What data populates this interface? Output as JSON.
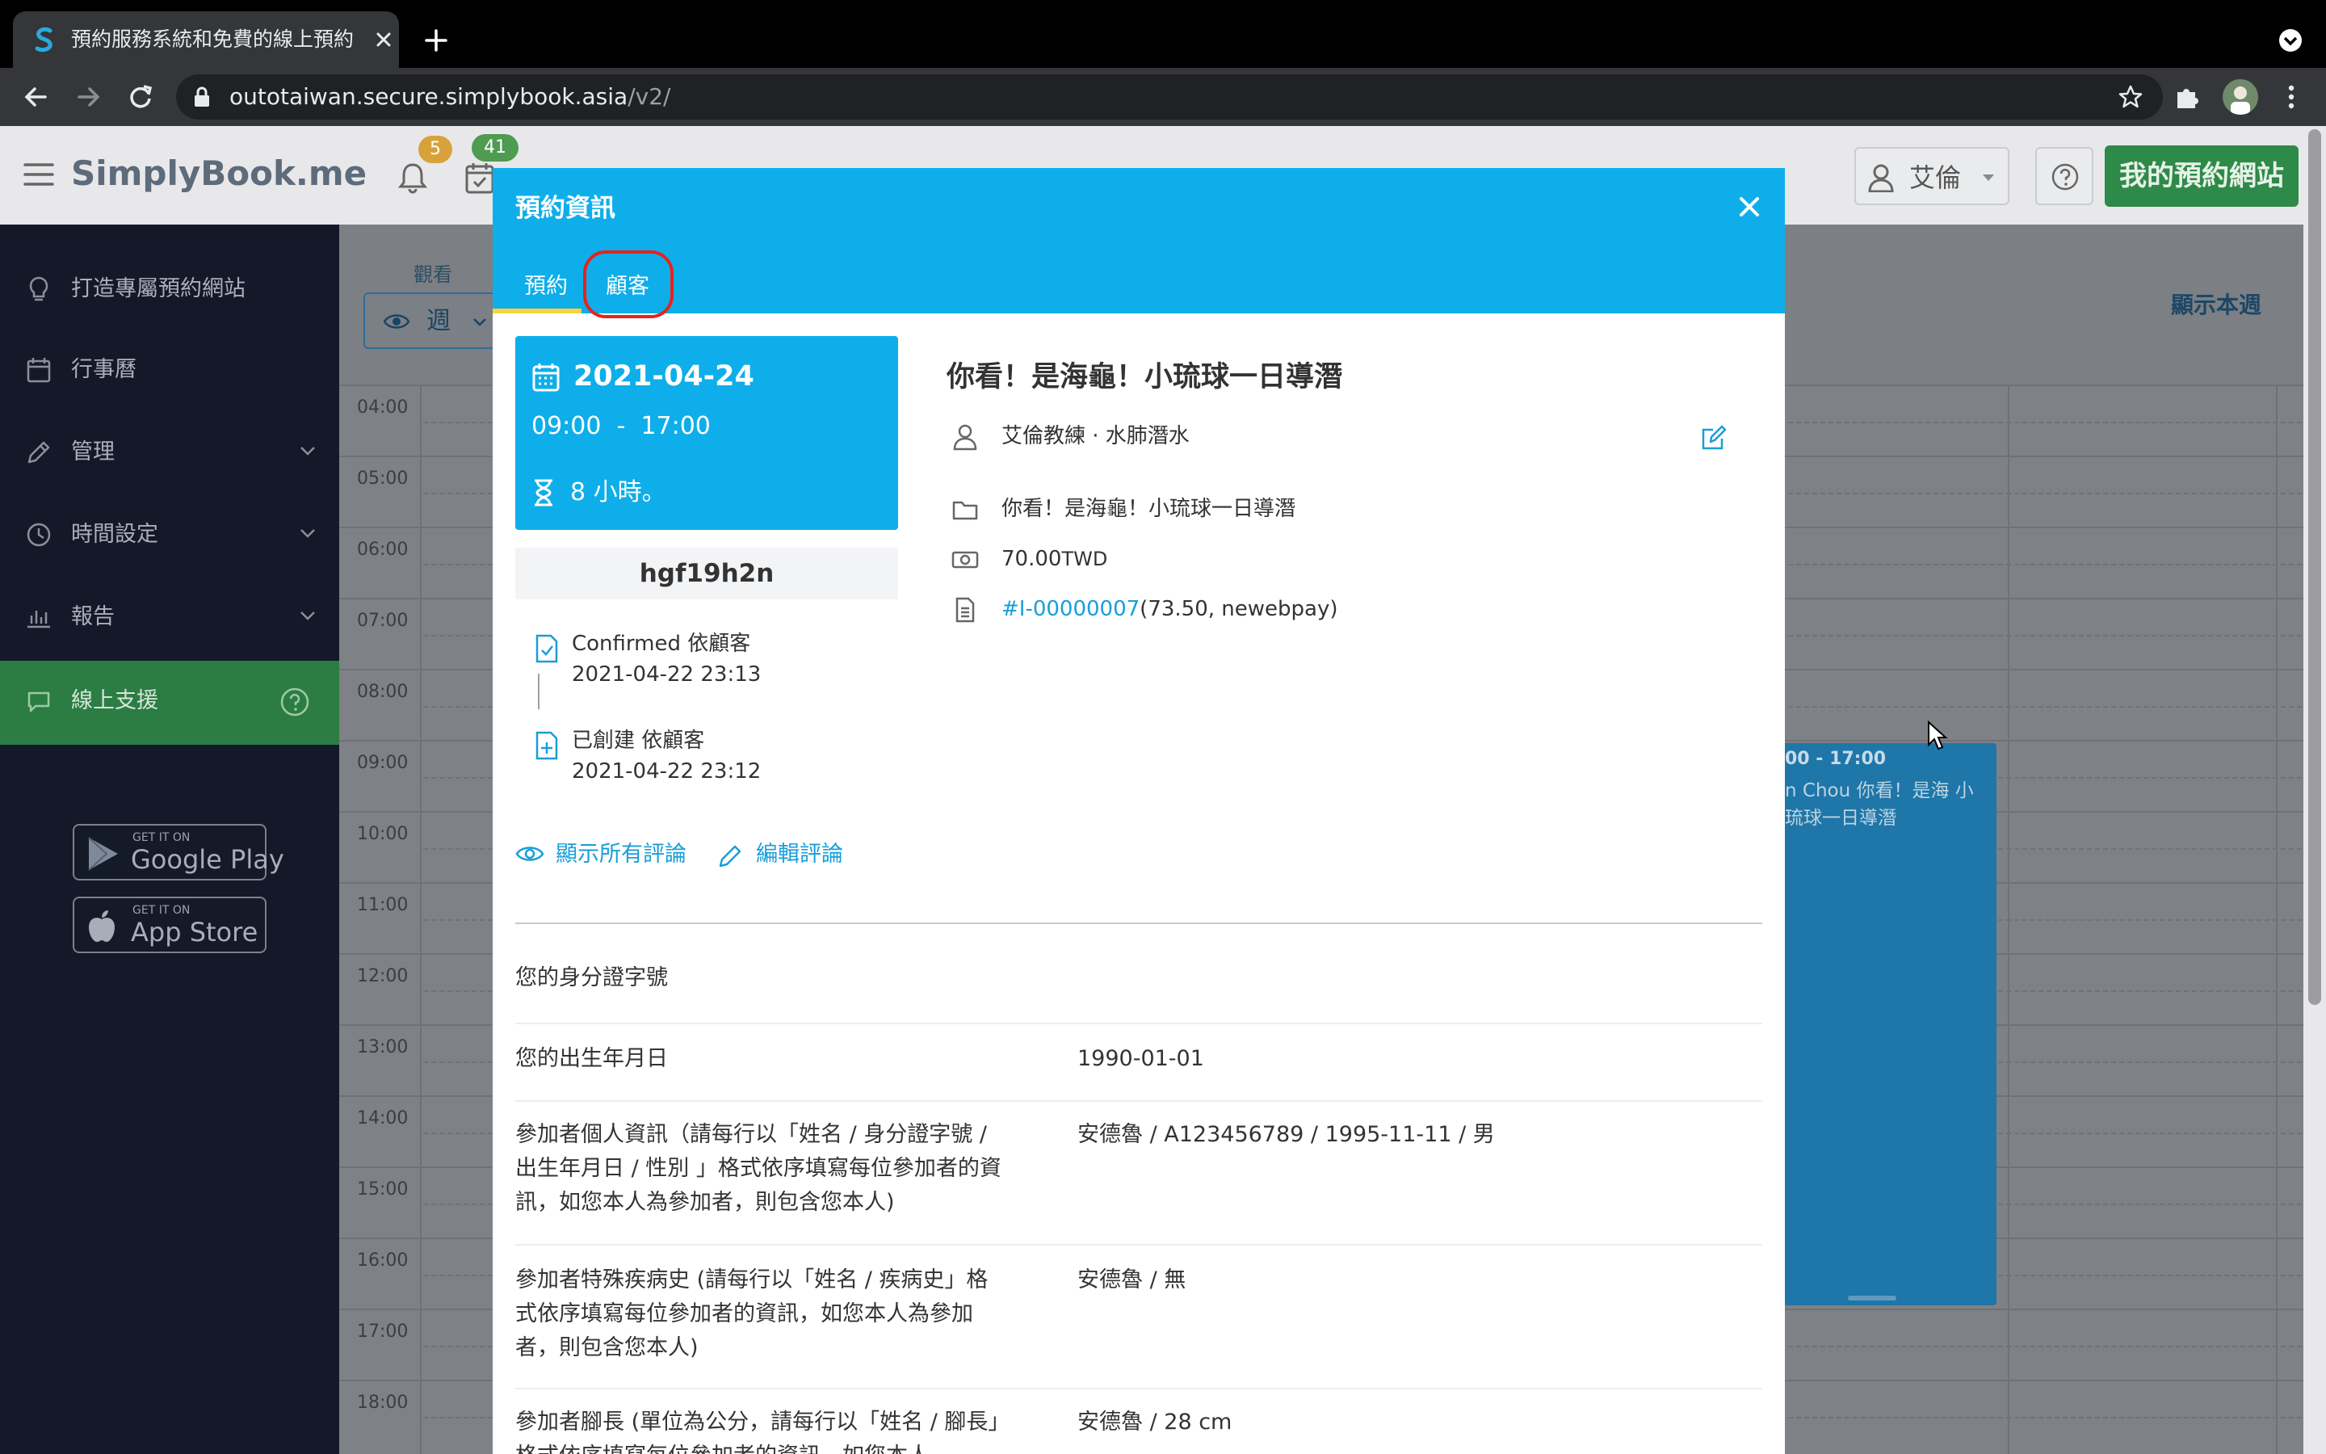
{
  "browser": {
    "tab_title": "預約服務系統和免費的線上預約",
    "url_host": "outotaiwan.secure.simplybook.asia",
    "url_path": "/v2/"
  },
  "app": {
    "logo": "SimplyBook.me",
    "notifications_count": "5",
    "bookings_count": "41",
    "user_name": "艾倫",
    "site_button": "我的預約網站"
  },
  "sidebar": {
    "items": [
      {
        "label": "打造專屬預約網站"
      },
      {
        "label": "行事曆"
      },
      {
        "label": "管理"
      },
      {
        "label": "時間設定"
      },
      {
        "label": "報告"
      },
      {
        "label": "線上支援"
      }
    ],
    "google_play_small": "GET IT ON",
    "google_play_big": "Google Play",
    "app_store_small": "GET IT ON",
    "app_store_big": "App Store"
  },
  "calendar": {
    "view_label": "觀看",
    "view_value": "週",
    "show_week": "顯示本週",
    "hours": [
      "04:00",
      "05:00",
      "06:00",
      "07:00",
      "08:00",
      "09:00",
      "10:00",
      "11:00",
      "12:00",
      "13:00",
      "14:00",
      "15:00",
      "16:00",
      "17:00",
      "18:00"
    ],
    "event_time": "00 - 17:00",
    "event_desc": "n Chou 你看！是海 小琉球一日導潛"
  },
  "modal": {
    "title": "預約資訊",
    "tab_booking": "預約",
    "tab_client": "顧客",
    "date": "2021-04-24",
    "time_range": "09:00  -  17:00",
    "duration": "8 小時。",
    "code": "hgf19h2n",
    "history": [
      {
        "status": "Confirmed 依顧客",
        "time": "2021-04-22 23:13"
      },
      {
        "status": "已創建 依顧客",
        "time": "2021-04-22 23:12"
      }
    ],
    "show_reviews": "顯示所有評論",
    "edit_review": "編輯評論",
    "service_title": "你看！是海龜！小琉球一日導潛",
    "provider": "艾倫教練 · 水肺潛水",
    "service": "你看！是海龜！小琉球一日導潛",
    "price": "70.00",
    "currency": "TWD",
    "invoice_link": "#I-00000007",
    "invoice_details": "(73.50, newebpay)",
    "fields": [
      {
        "label": "您的身分證字號",
        "value": ""
      },
      {
        "label": "您的出生年月日",
        "value": "1990-01-01"
      },
      {
        "label": "參加者個人資訊（請每行以「姓名 / 身分證字號 / 出生年月日 / 性別 」格式依序填寫每位參加者的資訊，如您本人為參加者，則包含您本人)",
        "value": "安德魯 / A123456789 / 1995-11-11 / 男"
      },
      {
        "label": "參加者特殊疾病史 (請每行以「姓名 / 疾病史」格式依序填寫每位參加者的資訊，如您本人為參加者，則包含您本人)",
        "value": "安德魯 / 無"
      },
      {
        "label": "參加者腳長 (單位為公分，請每行以「姓名 / 腳長」格式依序填寫每位參加者的資訊，如您本人",
        "value": "安德魯 / 28 cm"
      }
    ]
  },
  "colors": {
    "modal_header": "#0eaeea",
    "tab_underline": "#f8d43c",
    "highlight_ring": "#e8221b",
    "site_button": "#2e8a48",
    "sidebar_active": "#2c7d43",
    "link": "#199ed8"
  }
}
